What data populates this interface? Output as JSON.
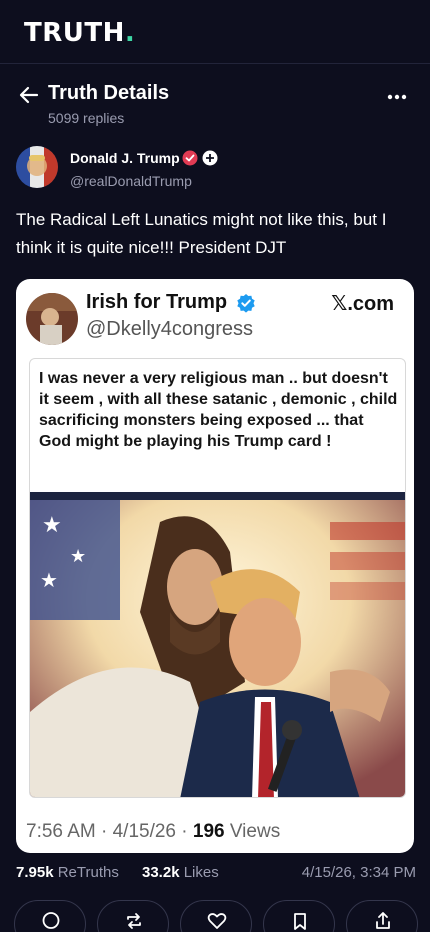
{
  "app": {
    "logo_text": "TRUTH",
    "logo_dot": ".",
    "accent": "#3ed6a5"
  },
  "header": {
    "back_icon": "arrow-left-icon",
    "title": "Truth Details",
    "subtitle": "5099 replies",
    "more_icon": "more-horizontal-icon"
  },
  "post": {
    "author_name": "Donald J. Trump",
    "author_handle": "@realDonaldTrump",
    "verified_icon": "verified-badge-icon",
    "plus_icon": "plus-badge-icon",
    "text": "The Radical Left Lunatics might not like this, but I think it is quite nice!!!  President DJT"
  },
  "embed": {
    "name": "Irish for Trump",
    "handle": "@Dkelly4congress",
    "source": ".com",
    "source_x": "𝕏",
    "meme_text": "I was never a very religious man .. but doesn't it seem , with all these satanic , demonic , child sacrificing monsters being exposed ... that God might be playing his Trump card !",
    "time": "7:56 AM · 4/15/26 · ",
    "views_count": "196",
    "views_label": " Views"
  },
  "stats": {
    "retruths_count": "7.95k",
    "retruths_label": " ReTruths",
    "likes_count": "33.2k",
    "likes_label": " Likes",
    "timestamp": "4/15/26, 3:34 PM"
  },
  "actions": [
    "reply-icon",
    "retruth-icon",
    "like-icon",
    "bookmark-icon",
    "share-icon"
  ]
}
